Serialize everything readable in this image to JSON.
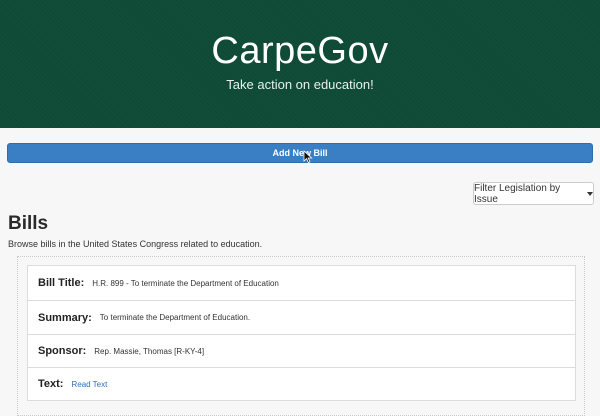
{
  "header": {
    "brand": "CarpeGov",
    "tagline": "Take action on education!"
  },
  "actions": {
    "add_bill_label": "Add New Bill",
    "filter_label": "Filter Legislation by Issue"
  },
  "bills": {
    "heading": "Bills",
    "description": "Browse bills in the United States Congress related to education.",
    "items": [
      {
        "title_label": "Bill Title:",
        "title_value": "H.R. 899 - To terminate the Department of Education",
        "summary_label": "Summary:",
        "summary_value": "To terminate the Department of Education.",
        "sponsor_label": "Sponsor:",
        "sponsor_value": "Rep. Massie, Thomas [R-KY-4]",
        "text_label": "Text:",
        "text_link": "Read Text"
      }
    ]
  },
  "colors": {
    "hero_background": "#0e4a36",
    "primary_button": "#3a7fc4",
    "link": "#2f6fb5"
  },
  "icons": {
    "cursor": "mouse-pointer-icon",
    "dropdown": "caret-down-icon"
  }
}
